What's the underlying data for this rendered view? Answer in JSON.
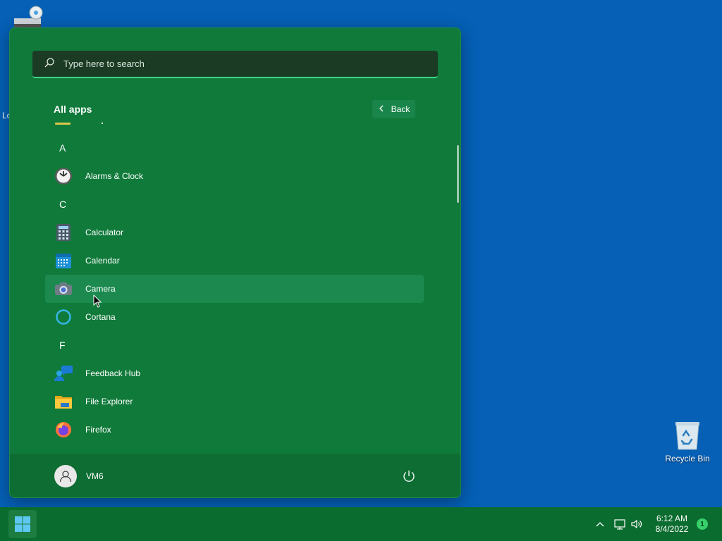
{
  "desktop": {
    "partial_label": "Lo",
    "recycle_bin_label": "Recycle Bin"
  },
  "start_menu": {
    "search": {
      "placeholder": "Type here to search"
    },
    "all_apps_title": "All apps",
    "back_label": "Back",
    "sections": [
      {
        "letter": "A",
        "apps": [
          "Alarms & Clock"
        ]
      },
      {
        "letter": "C",
        "apps": [
          "Calculator",
          "Calendar",
          "Camera",
          "Cortana"
        ]
      },
      {
        "letter": "F",
        "apps": [
          "Feedback Hub",
          "File Explorer",
          "Firefox"
        ]
      }
    ],
    "hovered_app": "Camera",
    "user": {
      "name": "VM6"
    }
  },
  "taskbar": {
    "time": "6:12 AM",
    "date": "8/4/2022",
    "notification_count": "1"
  },
  "icons": {
    "search": "search-icon",
    "back": "chevron-left-icon",
    "power": "power-icon",
    "start": "windows-logo-icon",
    "tray_chevron": "chevron-up-icon",
    "network": "network-icon",
    "volume": "volume-icon",
    "recycle": "recycle-bin-icon"
  },
  "colors": {
    "desktop_bg": "#0560b6",
    "start_menu_bg": "#107a3a",
    "taskbar_bg": "#0b6c2f",
    "search_accent": "#3fd68a"
  }
}
